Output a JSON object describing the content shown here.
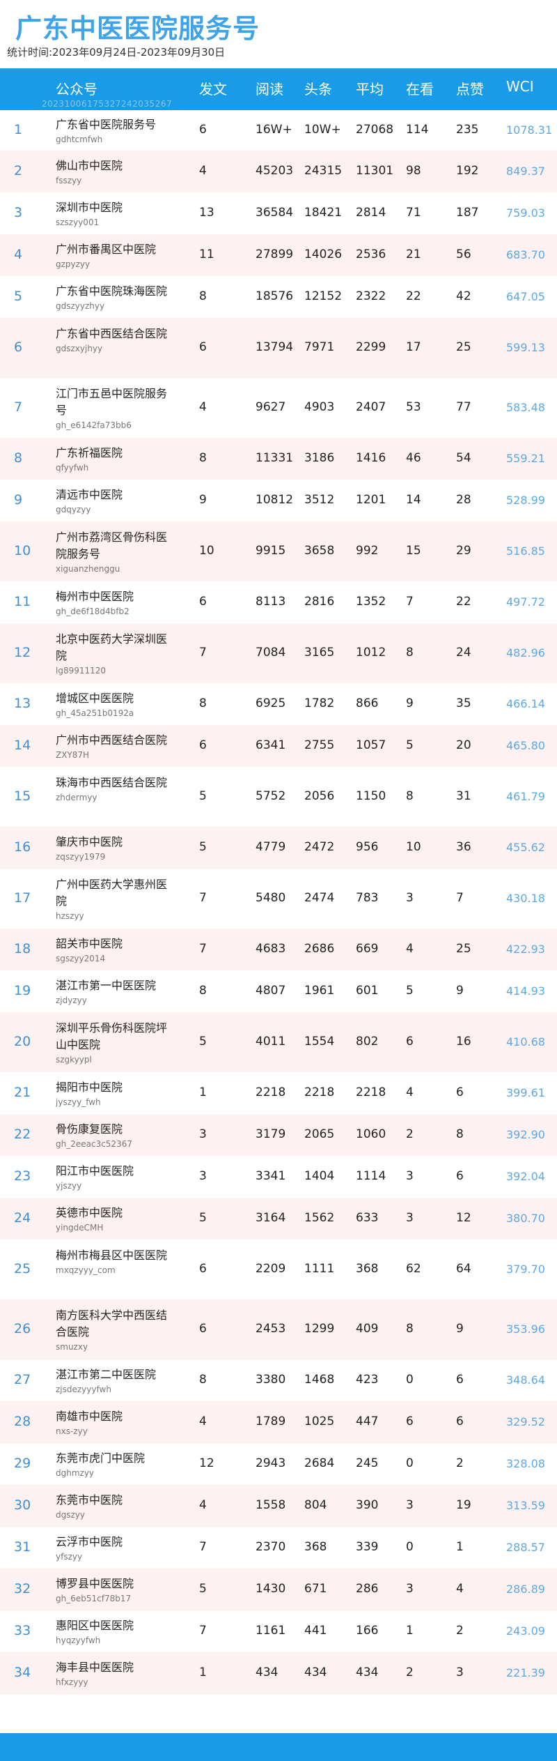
{
  "page": {
    "title": "广东中医医院服务号",
    "period": "统计时间:2023年09月24日-2023年09月30日",
    "id_code": "20231006175327242035267"
  },
  "columns": [
    "公众号",
    "发文",
    "阅读",
    "头条",
    "平均",
    "在看",
    "点赞",
    "WCI"
  ],
  "rows": [
    {
      "rank": "1",
      "name": "广东省中医院服务号",
      "account": "gdhtcmfwh",
      "posts": "6",
      "reads": "16W+",
      "headline": "10W+",
      "avg": "27068",
      "watching": "114",
      "likes": "235",
      "wci": "1078.31"
    },
    {
      "rank": "2",
      "name": "佛山市中医院",
      "account": "fsszyy",
      "posts": "4",
      "reads": "45203",
      "headline": "24315",
      "avg": "11301",
      "watching": "98",
      "likes": "192",
      "wci": "849.37"
    },
    {
      "rank": "3",
      "name": "深圳市中医院",
      "account": "szszyy001",
      "posts": "13",
      "reads": "36584",
      "headline": "18421",
      "avg": "2814",
      "watching": "71",
      "likes": "187",
      "wci": "759.03"
    },
    {
      "rank": "4",
      "name": "广州市番禺区中医院",
      "account": "gzpyzyy",
      "posts": "11",
      "reads": "27899",
      "headline": "14026",
      "avg": "2536",
      "watching": "21",
      "likes": "56",
      "wci": "683.70"
    },
    {
      "rank": "5",
      "name": "广东省中医院珠海医院",
      "account": "gdszyyzhyy",
      "posts": "8",
      "reads": "18576",
      "headline": "12152",
      "avg": "2322",
      "watching": "22",
      "likes": "42",
      "wci": "647.05"
    },
    {
      "rank": "6",
      "name": "广东省中西医结合医院",
      "account": "gdszxyjhyy",
      "posts": "6",
      "reads": "13794",
      "headline": "7971",
      "avg": "2299",
      "watching": "17",
      "likes": "25",
      "wci": "599.13"
    },
    {
      "rank": "7",
      "name": "江门市五邑中医院服务号",
      "account": "gh_e6142fa73bb6",
      "posts": "4",
      "reads": "9627",
      "headline": "4903",
      "avg": "2407",
      "watching": "53",
      "likes": "77",
      "wci": "583.48"
    },
    {
      "rank": "8",
      "name": "广东祈福医院",
      "account": "qfyyfwh",
      "posts": "8",
      "reads": "11331",
      "headline": "3186",
      "avg": "1416",
      "watching": "46",
      "likes": "54",
      "wci": "559.21"
    },
    {
      "rank": "9",
      "name": "清远市中医院",
      "account": "gdqyzyy",
      "posts": "9",
      "reads": "10812",
      "headline": "3512",
      "avg": "1201",
      "watching": "14",
      "likes": "28",
      "wci": "528.99"
    },
    {
      "rank": "10",
      "name": "广州市荔湾区骨伤科医院服务号",
      "account": "xiguanzhenggu",
      "posts": "10",
      "reads": "9915",
      "headline": "3658",
      "avg": "992",
      "watching": "15",
      "likes": "29",
      "wci": "516.85"
    },
    {
      "rank": "11",
      "name": "梅州市中医医院",
      "account": "gh_de6f18d4bfb2",
      "posts": "6",
      "reads": "8113",
      "headline": "2816",
      "avg": "1352",
      "watching": "7",
      "likes": "22",
      "wci": "497.72"
    },
    {
      "rank": "12",
      "name": "北京中医药大学深圳医院",
      "account": "lg89911120",
      "posts": "7",
      "reads": "7084",
      "headline": "3165",
      "avg": "1012",
      "watching": "8",
      "likes": "24",
      "wci": "482.96"
    },
    {
      "rank": "13",
      "name": "增城区中医医院",
      "account": "gh_45a251b0192a",
      "posts": "8",
      "reads": "6925",
      "headline": "1782",
      "avg": "866",
      "watching": "9",
      "likes": "35",
      "wci": "466.14"
    },
    {
      "rank": "14",
      "name": "广州市中西医结合医院",
      "account": "ZXY87H",
      "posts": "6",
      "reads": "6341",
      "headline": "2755",
      "avg": "1057",
      "watching": "5",
      "likes": "20",
      "wci": "465.80"
    },
    {
      "rank": "15",
      "name": "珠海市中西医结合医院",
      "account": "zhdermyy",
      "posts": "5",
      "reads": "5752",
      "headline": "2056",
      "avg": "1150",
      "watching": "8",
      "likes": "31",
      "wci": "461.79"
    },
    {
      "rank": "16",
      "name": "肇庆市中医院",
      "account": "zqszyy1979",
      "posts": "5",
      "reads": "4779",
      "headline": "2472",
      "avg": "956",
      "watching": "10",
      "likes": "36",
      "wci": "455.62"
    },
    {
      "rank": "17",
      "name": "广州中医药大学惠州医院",
      "account": "hzszyy",
      "posts": "7",
      "reads": "5480",
      "headline": "2474",
      "avg": "783",
      "watching": "3",
      "likes": "7",
      "wci": "430.18"
    },
    {
      "rank": "18",
      "name": "韶关市中医院",
      "account": "sgszyy2014",
      "posts": "7",
      "reads": "4683",
      "headline": "2686",
      "avg": "669",
      "watching": "4",
      "likes": "25",
      "wci": "422.93"
    },
    {
      "rank": "19",
      "name": "湛江市第一中医医院",
      "account": "zjdyzyy",
      "posts": "8",
      "reads": "4807",
      "headline": "1961",
      "avg": "601",
      "watching": "5",
      "likes": "9",
      "wci": "414.93"
    },
    {
      "rank": "20",
      "name": "深圳平乐骨伤科医院坪山中医院",
      "account": "szgkyypl",
      "posts": "5",
      "reads": "4011",
      "headline": "1554",
      "avg": "802",
      "watching": "6",
      "likes": "16",
      "wci": "410.68"
    },
    {
      "rank": "21",
      "name": "揭阳市中医院",
      "account": "jyszyy_fwh",
      "posts": "1",
      "reads": "2218",
      "headline": "2218",
      "avg": "2218",
      "watching": "4",
      "likes": "6",
      "wci": "399.61"
    },
    {
      "rank": "22",
      "name": "骨伤康复医院",
      "account": "gh_2eeac3c52367",
      "posts": "3",
      "reads": "3179",
      "headline": "2065",
      "avg": "1060",
      "watching": "2",
      "likes": "8",
      "wci": "392.90"
    },
    {
      "rank": "23",
      "name": "阳江市中医医院",
      "account": "yjszyy",
      "posts": "3",
      "reads": "3341",
      "headline": "1404",
      "avg": "1114",
      "watching": "3",
      "likes": "6",
      "wci": "392.04"
    },
    {
      "rank": "24",
      "name": "英德市中医院",
      "account": "yingdeCMH",
      "posts": "5",
      "reads": "3164",
      "headline": "1562",
      "avg": "633",
      "watching": "3",
      "likes": "12",
      "wci": "380.70"
    },
    {
      "rank": "25",
      "name": "梅州市梅县区中医医院",
      "account": "mxqzyyy_com",
      "posts": "6",
      "reads": "2209",
      "headline": "1111",
      "avg": "368",
      "watching": "62",
      "likes": "64",
      "wci": "379.70"
    },
    {
      "rank": "26",
      "name": "南方医科大学中西医结合医院",
      "account": "smuzxy",
      "posts": "6",
      "reads": "2453",
      "headline": "1299",
      "avg": "409",
      "watching": "8",
      "likes": "9",
      "wci": "353.96"
    },
    {
      "rank": "27",
      "name": "湛江市第二中医医院",
      "account": "zjsdezyyyfwh",
      "posts": "8",
      "reads": "3380",
      "headline": "1468",
      "avg": "423",
      "watching": "0",
      "likes": "6",
      "wci": "348.64"
    },
    {
      "rank": "28",
      "name": "南雄市中医院",
      "account": "nxs-zyy",
      "posts": "4",
      "reads": "1789",
      "headline": "1025",
      "avg": "447",
      "watching": "6",
      "likes": "6",
      "wci": "329.52"
    },
    {
      "rank": "29",
      "name": "东莞市虎门中医院",
      "account": "dghmzyy",
      "posts": "12",
      "reads": "2943",
      "headline": "2684",
      "avg": "245",
      "watching": "0",
      "likes": "2",
      "wci": "328.08"
    },
    {
      "rank": "30",
      "name": "东莞市中医院",
      "account": "dgszyy",
      "posts": "4",
      "reads": "1558",
      "headline": "804",
      "avg": "390",
      "watching": "3",
      "likes": "19",
      "wci": "313.59"
    },
    {
      "rank": "31",
      "name": "云浮市中医院",
      "account": "yfszyy",
      "posts": "7",
      "reads": "2370",
      "headline": "368",
      "avg": "339",
      "watching": "0",
      "likes": "1",
      "wci": "288.57"
    },
    {
      "rank": "32",
      "name": "博罗县中医医院",
      "account": "gh_6eb51cf78b17",
      "posts": "5",
      "reads": "1430",
      "headline": "671",
      "avg": "286",
      "watching": "3",
      "likes": "4",
      "wci": "286.89"
    },
    {
      "rank": "33",
      "name": "惠阳区中医医院",
      "account": "hyqzyyfwh",
      "posts": "7",
      "reads": "1161",
      "headline": "441",
      "avg": "166",
      "watching": "1",
      "likes": "2",
      "wci": "243.09"
    },
    {
      "rank": "34",
      "name": "海丰县中医医院",
      "account": "hfxzyyy",
      "posts": "1",
      "reads": "434",
      "headline": "434",
      "avg": "434",
      "watching": "2",
      "likes": "3",
      "wci": "221.39"
    }
  ]
}
